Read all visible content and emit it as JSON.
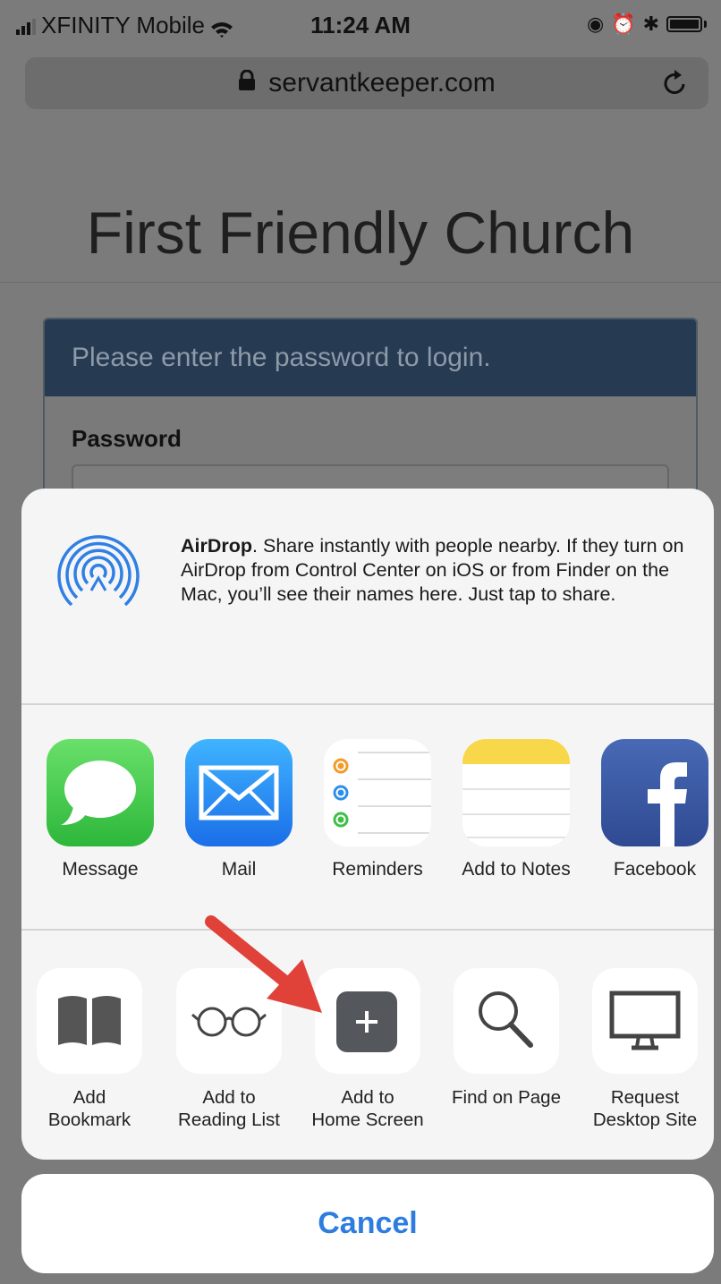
{
  "status_bar": {
    "carrier": "XFINITY Mobile",
    "time": "11:24 AM"
  },
  "browser": {
    "url": "servantkeeper.com"
  },
  "page": {
    "title": "First Friendly Church",
    "login_prompt": "Please enter the password to login.",
    "password_label": "Password"
  },
  "share_sheet": {
    "airdrop": {
      "title": "AirDrop",
      "description": ". Share instantly with people nearby. If they turn on AirDrop from Control Center on iOS or from Finder on the Mac, you’ll see their names here. Just tap to share."
    },
    "apps": [
      {
        "label": "Message",
        "icon": "messages-icon"
      },
      {
        "label": "Mail",
        "icon": "mail-icon"
      },
      {
        "label": "Reminders",
        "icon": "reminders-icon"
      },
      {
        "label": "Add to Notes",
        "icon": "notes-icon"
      },
      {
        "label": "Facebook",
        "icon": "facebook-icon"
      }
    ],
    "actions": [
      {
        "line1": "Add",
        "line2": "Bookmark",
        "icon": "book-icon"
      },
      {
        "line1": "Add to",
        "line2": "Reading List",
        "icon": "glasses-icon"
      },
      {
        "line1": "Add to",
        "line2": "Home Screen",
        "icon": "plus-square-icon"
      },
      {
        "line1": "Find on Page",
        "line2": "",
        "icon": "magnifier-icon"
      },
      {
        "line1": "Request",
        "line2": "Desktop Site",
        "icon": "monitor-icon"
      }
    ],
    "cancel_label": "Cancel"
  },
  "colors": {
    "accent": "#2d7de0",
    "panel_header": "#263a52",
    "highlight_arrow": "#e0423a"
  }
}
